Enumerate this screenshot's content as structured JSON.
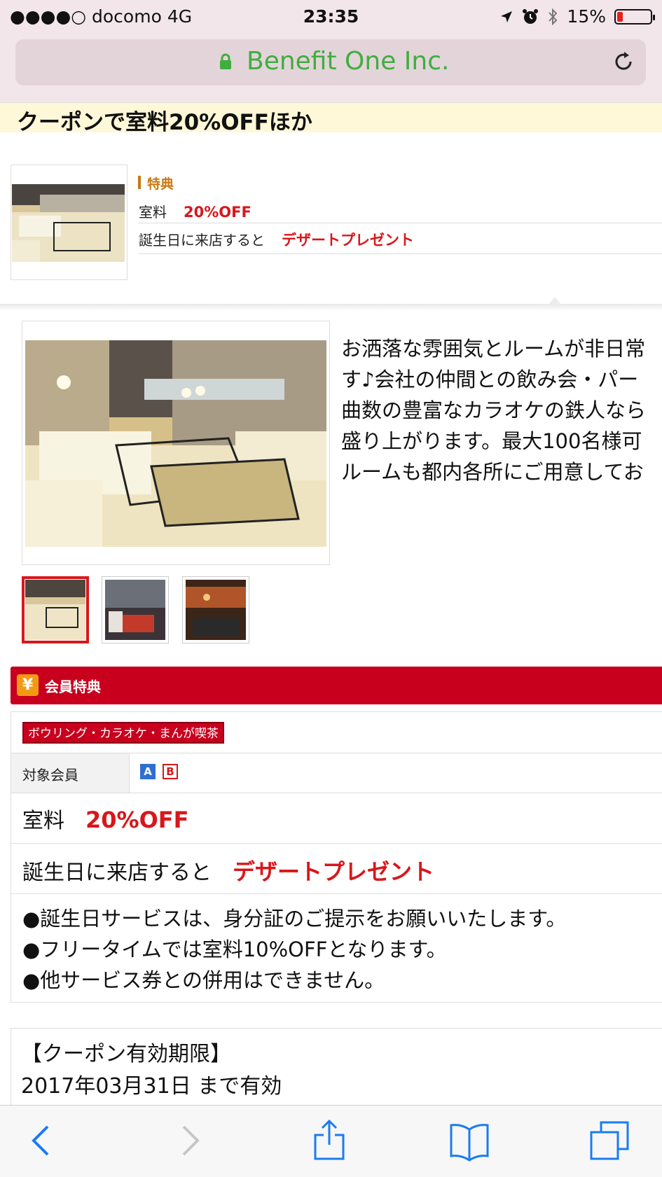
{
  "status_bar": {
    "carrier": "●●●●○ docomo   4G",
    "time": "23:35",
    "battery": "15%",
    "icons": [
      "location-arrow-icon",
      "alarm-icon",
      "bluetooth-icon",
      "battery-icon"
    ]
  },
  "browser": {
    "host": "Benefit One Inc.",
    "icons": [
      "lock-icon",
      "reload-icon"
    ]
  },
  "header": {
    "title": "クーポンで室料20%OFFほか"
  },
  "summary": {
    "section_label": "特典",
    "row1_label": "室料",
    "row1_value": "20%OFF",
    "row2_label": "誕生日に来店すると",
    "row2_value": "デザートプレゼント"
  },
  "description": "お洒落な雰囲気とルームが非日常\nす♪会社の仲間との飲み会・パー\n曲数の豊富なカラオケの鉄人なら\n盛り上がります。最大100名様可\nルームも都内各所にご用意してお",
  "gallery": {
    "selected_index": 0,
    "count": 3
  },
  "member": {
    "header_icon_text": "¥",
    "header_label": "会員特典",
    "category": "ボウリング・カラオケ・まんが喫茶",
    "target_label": "対象会員",
    "target_badges": [
      "A",
      "B"
    ],
    "benefit1_label": "室料",
    "benefit1_value": "20%OFF",
    "benefit2_label": "誕生日に来店すると",
    "benefit2_value": "デザートプレゼント",
    "notes": [
      "●誕生日サービスは、身分証のご提示をお願いいたします。",
      "●フリータイムでは室料10%OFFとなります。",
      "●他サービス券との併用はできません。"
    ]
  },
  "expiry": {
    "heading": "【クーポン有効期限】",
    "value": "2017年03月31日 まで有効"
  },
  "toolbar": {
    "icons": [
      "back-icon",
      "forward-icon",
      "share-icon",
      "bookmarks-icon",
      "tabs-icon"
    ]
  },
  "colors": {
    "accent_red": "#d8171b",
    "member_header": "#c8001e",
    "tokuten_brown": "#c87a14",
    "url_green": "#3fae3f",
    "ios_blue": "#1a7cf0"
  }
}
